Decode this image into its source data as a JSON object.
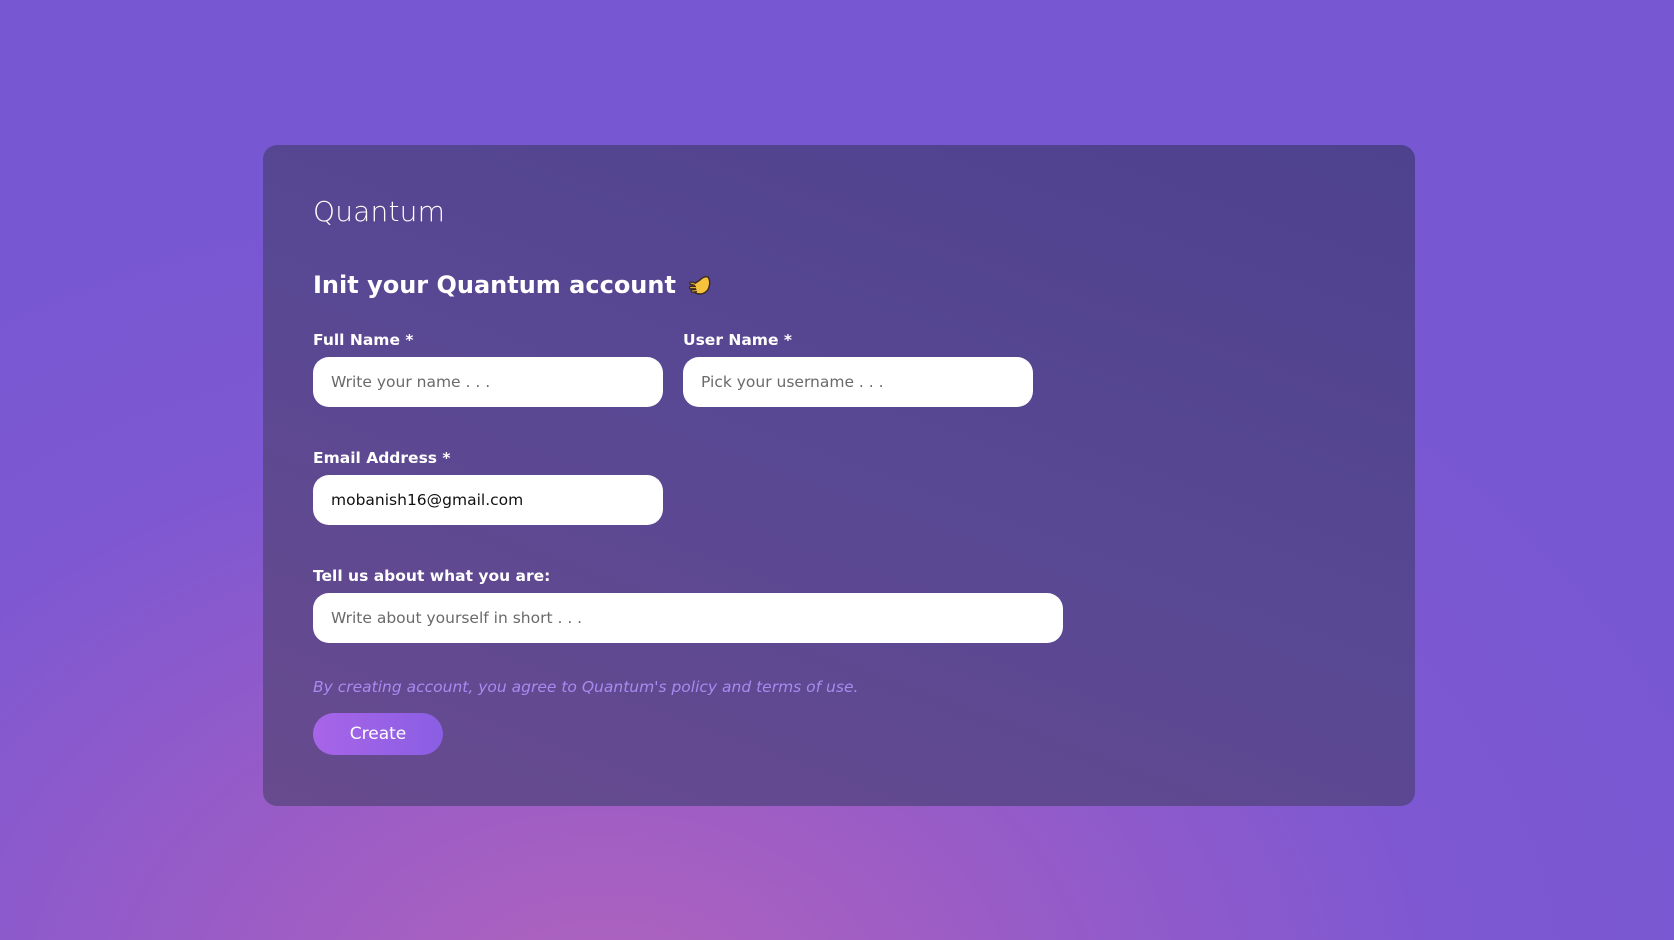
{
  "brand": {
    "name": "Quantum"
  },
  "heading": {
    "text": "Init your Quantum account",
    "icon": "hand-wave-icon"
  },
  "form": {
    "full_name": {
      "label": "Full Name *",
      "placeholder": "Write your name . . .",
      "value": ""
    },
    "user_name": {
      "label": "User Name *",
      "placeholder": "Pick your username . . .",
      "value": ""
    },
    "email": {
      "label": "Email Address *",
      "placeholder": "",
      "value": "mobanish16@gmail.com"
    },
    "about": {
      "label": "Tell us about what you are:",
      "placeholder": "Write about yourself in short . . .",
      "value": ""
    }
  },
  "terms": {
    "text": "By creating account, you agree to Quantum's policy and terms of use."
  },
  "actions": {
    "create_label": "Create"
  },
  "colors": {
    "background": "#7d58d2",
    "card": "#594893",
    "accent": "#a865e8",
    "terms_text": "#a88af0"
  }
}
